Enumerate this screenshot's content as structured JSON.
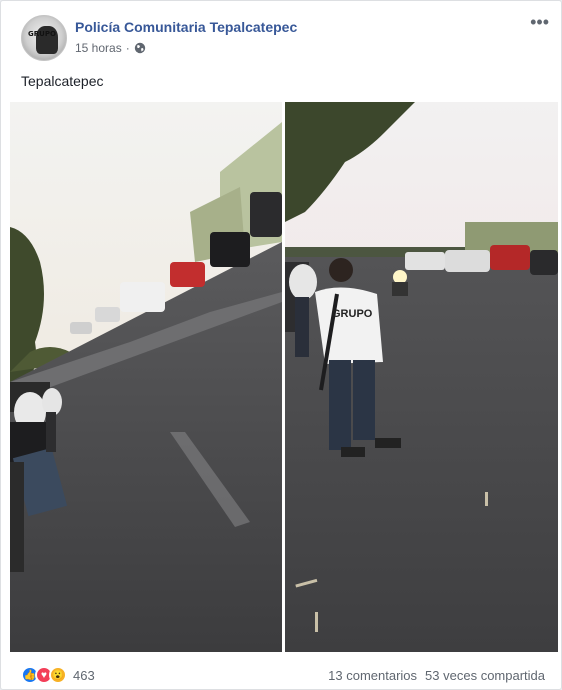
{
  "post": {
    "page_name": "Policía Comunitaria Tepalcatepec",
    "time": "15 horas",
    "privacy_icon": "globe-icon",
    "more_icon": "ellipsis-icon",
    "text": "Tepalcatepec",
    "avatar_text": "GRUPO"
  },
  "photos": {
    "left_shirt_text": "",
    "right_shirt_text": "GRUPO"
  },
  "footer": {
    "reaction_icons": [
      "like-icon",
      "love-icon",
      "wow-icon"
    ],
    "reaction_count": "463",
    "comments": "13 comentarios",
    "shares": "53 veces compartida"
  },
  "colors": {
    "link": "#385898",
    "like": "#1877f2",
    "love": "#f33e58",
    "wow": "#f7b125"
  }
}
